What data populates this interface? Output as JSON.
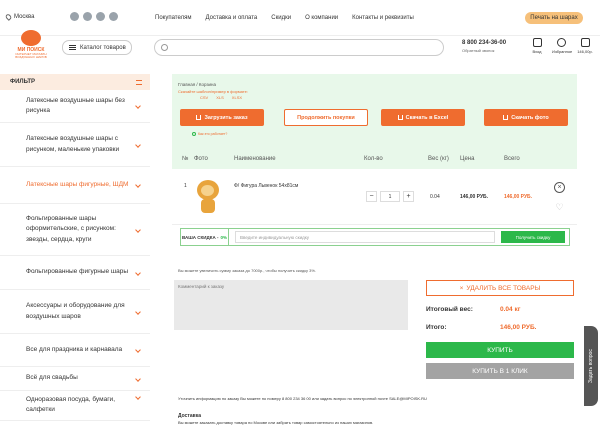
{
  "topbar": {
    "city": "Москва",
    "nav": [
      "Покупателям",
      "Доставка и оплата",
      "Скидки",
      "О компании",
      "Контакты и реквизиты"
    ],
    "print_label": "Печать на шарах"
  },
  "header": {
    "logo_brand": "МИ ПОИСК",
    "logo_tag": "ИНТЕРНЕТ МАГАЗИН ВОЗДУШНЫХ ШАРОВ",
    "catalog_label": "Каталог товаров",
    "search_placeholder": "",
    "phone": "8 800 234-36-00",
    "callback": "Обратный звонок",
    "icons": [
      {
        "label": "Вход",
        "name": "user-icon"
      },
      {
        "label": "Избранное",
        "name": "heart-icon"
      },
      {
        "label": "146,00р.",
        "name": "cart-icon"
      }
    ]
  },
  "sidebar": {
    "filter_label": "ФИЛЬТР",
    "items": [
      {
        "label": "Латексные воздушные шары без рисунка",
        "active": false
      },
      {
        "label": "Латексные воздушные шары с рисунком, маленькие упаковки",
        "active": false
      },
      {
        "label": "Латексные шары фигурные, ШДМ",
        "active": true
      },
      {
        "label": "Фольгированные шары оформительские, с рисунком: звезды, сердца, круги",
        "active": false
      },
      {
        "label": "Фольгированные фигурные шары",
        "active": false
      },
      {
        "label": "Аксессуары и оборудование для воздушных шаров",
        "active": false
      },
      {
        "label": "Все для праздника и карнавала",
        "active": false
      },
      {
        "label": "Всё для свадьбы",
        "active": false
      },
      {
        "label": "Одноразовая посуда, бумаги, салфетки",
        "active": false
      }
    ]
  },
  "cart": {
    "breadcrumbs": "Главная / Корзина",
    "template_text": "Скачайте шаблон/пример в формате:",
    "formats": [
      "CSV",
      "XLS",
      "XLSX"
    ],
    "upload_label": "Загрузить заказ",
    "continue_label": "Продолжить покупки",
    "excel_label": "Скачать в Excel",
    "photo_label": "Скачать фото",
    "howto_label": "Как это работает?",
    "columns": [
      "№",
      "Фото",
      "Наименование",
      "Кол-во",
      "Вес (кг)",
      "Цена",
      "Всего"
    ],
    "row": {
      "num": "1",
      "name": "Ф/ Фигура Львенок 54х81см",
      "qty": "1",
      "weight": "0.04",
      "price": "146,00 РУБ.",
      "total": "146,00 РУБ."
    },
    "discount_label": "ВАША СКИДКА -",
    "discount_pct": "0%",
    "discount_placeholder": "Введите индивидуальную скидку",
    "discount_btn": "Получить скидку",
    "increase_note": "Вы можете увеличить сумму заказа до 7000р., чтобы получить скидку 3%.",
    "comment_placeholder": "Комментарий к заказу",
    "delete_all": "УДАЛИТЬ ВСЕ ТОВАРЫ",
    "weight_label": "Итоговый вес:",
    "weight_value": "0.04 кг",
    "total_label": "Итого:",
    "total_value": "146,00 РУБ.",
    "buy_label": "КУПИТЬ",
    "buy1_label": "КУПИТЬ В 1 КЛИК",
    "info_text": "Уточнить информацию по заказу Вы можете по номеру 8 800 234 36 00 или задать вопрос по электронной почте SALE@MIPOISK.RU",
    "delivery_title": "Доставка",
    "delivery_text": "Вы можете заказать доставку товара по Москве или забрать товар самостоятельно из наших магазинов.",
    "ask_label": "Задать вопрос"
  }
}
